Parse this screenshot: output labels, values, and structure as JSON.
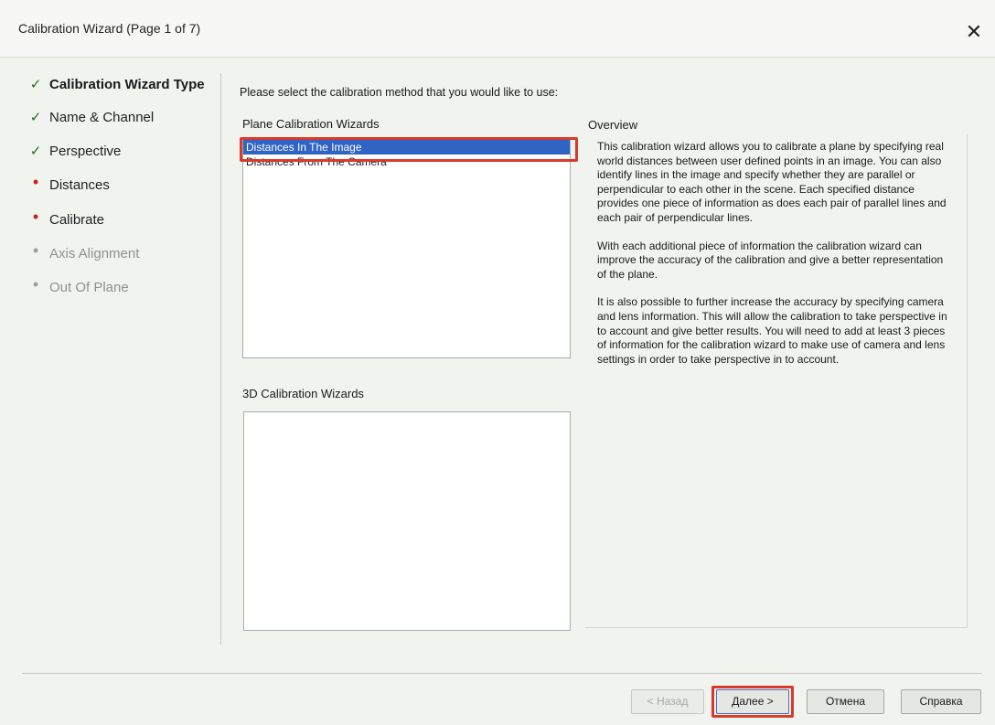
{
  "window": {
    "title": "Calibration Wizard (Page 1 of 7)",
    "close_symbol": "✕"
  },
  "steps": [
    {
      "label": "Calibration Wizard Type",
      "state": "active",
      "mark": "✓"
    },
    {
      "label": "Name & Channel",
      "state": "done",
      "mark": "✓"
    },
    {
      "label": "Perspective",
      "state": "done",
      "mark": "✓"
    },
    {
      "label": "Distances",
      "state": "pending",
      "mark": "•"
    },
    {
      "label": "Calibrate",
      "state": "pending",
      "mark": "•"
    },
    {
      "label": "Axis Alignment",
      "state": "disabled",
      "mark": "•"
    },
    {
      "label": "Out Of Plane",
      "state": "disabled",
      "mark": "•"
    }
  ],
  "main": {
    "prompt": "Please select the calibration method that you would like to use:",
    "plane_group_label": "Plane Calibration Wizards",
    "plane_items": [
      "Distances In The Image",
      "Distances From The Camera"
    ],
    "selected_plane_item": "Distances In The Image",
    "d3_group_label": "3D Calibration Wizards",
    "overview_label": "Overview",
    "overview_paragraphs": [
      "This calibration wizard allows you to calibrate a plane by specifying real world distances between user defined points in an image. You can also identify lines in the image and specify whether they are parallel or perpendicular to each other in the scene. Each specified distance provides one piece of information as does each pair of parallel lines and each pair of perpendicular lines.",
      "With each additional piece of information the calibration wizard can improve the accuracy of the calibration and give a better representation of the plane.",
      "It is also possible to further increase the accuracy by specifying camera and lens information. This will allow the calibration to take perspective in to account and give better results. You will need to add at least 3 pieces of information for the calibration wizard to make use of camera and lens settings in order to take perspective in to account."
    ]
  },
  "buttons": {
    "back": "< Назад",
    "next": "Далее >",
    "cancel": "Отмена",
    "help": "Справка"
  },
  "colors": {
    "selection": "#2f63c4",
    "highlight": "#d93a2b",
    "check": "#1c6f1c",
    "pending_dot": "#c22424"
  }
}
